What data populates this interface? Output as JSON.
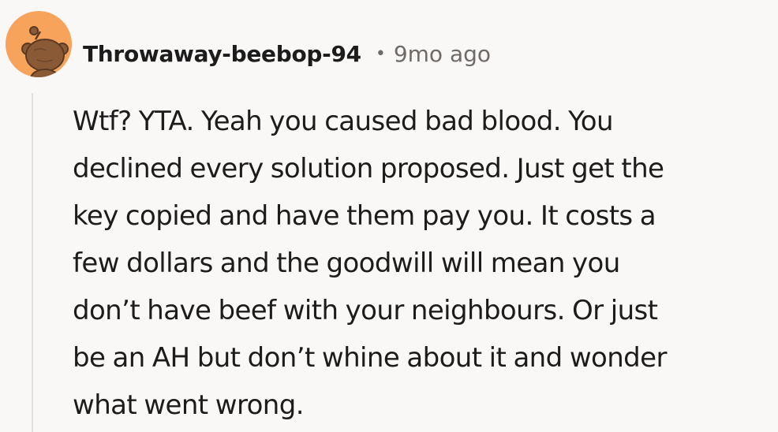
{
  "comment": {
    "author": "Throwaway-beebop-94",
    "separator": "•",
    "timestamp": "9mo ago",
    "avatar_icon": "snoo-avatar-icon",
    "avatar_color": "#f7a35c",
    "body_lines": [
      "Wtf? YTA. Yeah you caused bad blood. You",
      "declined every solution proposed. Just get the",
      "key copied and have them pay you. It costs a",
      "few dollars and the goodwill will mean you",
      "don’t have beef with your neighbours. Or just",
      "be an AH but don’t whine about it and wonder",
      "what went wrong."
    ]
  }
}
